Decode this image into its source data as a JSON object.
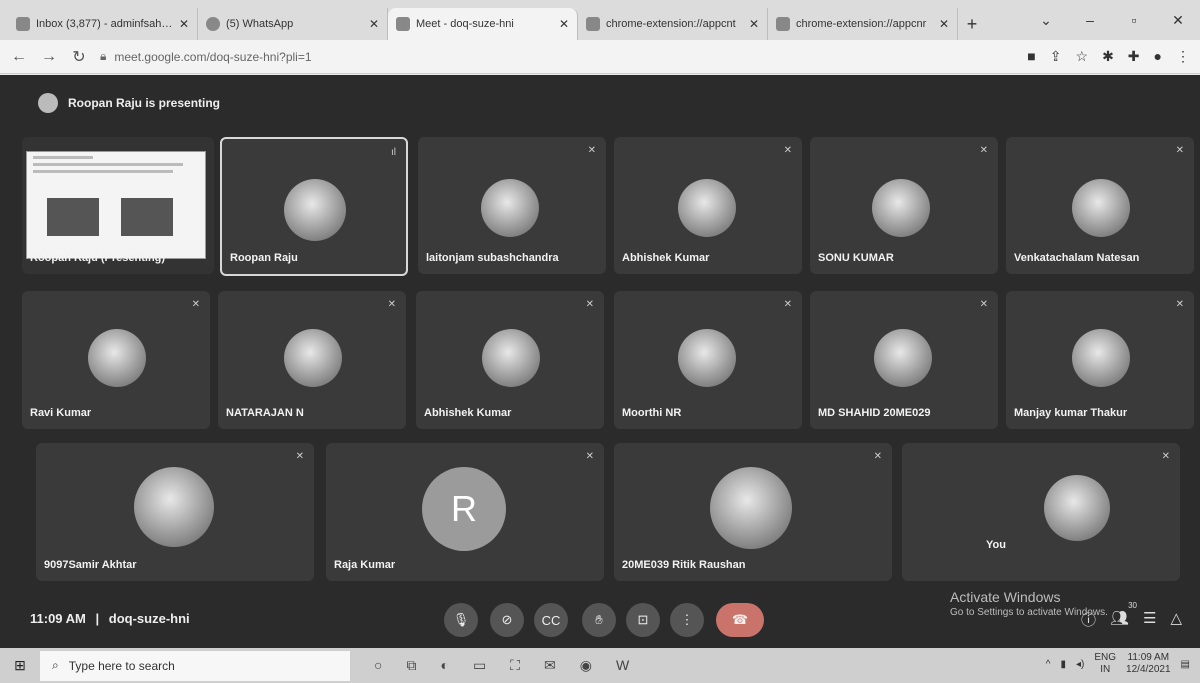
{
  "browser": {
    "tabs": [
      {
        "title": "Inbox (3,877) - adminfsahi@",
        "icon": "gmail-icon",
        "active": false
      },
      {
        "title": "(5) WhatsApp",
        "icon": "whatsapp-icon",
        "active": false
      },
      {
        "title": "Meet - doq-suze-hni",
        "icon": "meet-icon",
        "active": true
      },
      {
        "title": "chrome-extension://appcnt",
        "icon": "extension-icon",
        "active": false
      },
      {
        "title": "chrome-extension://appcnr",
        "icon": "extension-icon",
        "active": false
      }
    ],
    "url": "meet.google.com/doq-suze-hni?pli=1"
  },
  "meet": {
    "presenting_text": "Roopan Raju is presenting",
    "participants": [
      {
        "name": "Roopan Raju (Presenting)",
        "type": "screen"
      },
      {
        "name": "Roopan Raju",
        "type": "avatar"
      },
      {
        "name": "laitonjam subashchandra",
        "type": "avatar"
      },
      {
        "name": "Abhishek Kumar",
        "type": "avatar"
      },
      {
        "name": "SONU KUMAR",
        "type": "avatar"
      },
      {
        "name": "Venkatachalam Natesan",
        "type": "avatar"
      },
      {
        "name": "Ravi Kumar",
        "type": "avatar"
      },
      {
        "name": "NATARAJAN N",
        "type": "avatar"
      },
      {
        "name": "Abhishek Kumar",
        "type": "avatar"
      },
      {
        "name": "Moorthi NR",
        "type": "avatar"
      },
      {
        "name": "MD SHAHID 20ME029",
        "type": "avatar"
      },
      {
        "name": "Manjay kumar Thakur",
        "type": "avatar"
      },
      {
        "name": "9097Samir Akhtar",
        "type": "avatar"
      },
      {
        "name": "Raja Kumar",
        "type": "letter",
        "letter": "R"
      },
      {
        "name": "20ME039 Ritik Raushan",
        "type": "avatar"
      },
      {
        "name": "You",
        "type": "avatar"
      }
    ],
    "time": "11:09 AM",
    "meeting_code": "doq-suze-hni",
    "separator": "|",
    "people_count": "30",
    "watermark_title": "Activate Windows",
    "watermark_sub": "Go to Settings to activate Windows."
  },
  "taskbar": {
    "search_placeholder": "Type here to search",
    "lang": "ENG",
    "region": "IN",
    "time": "11:09 AM",
    "date": "12/4/2021"
  }
}
